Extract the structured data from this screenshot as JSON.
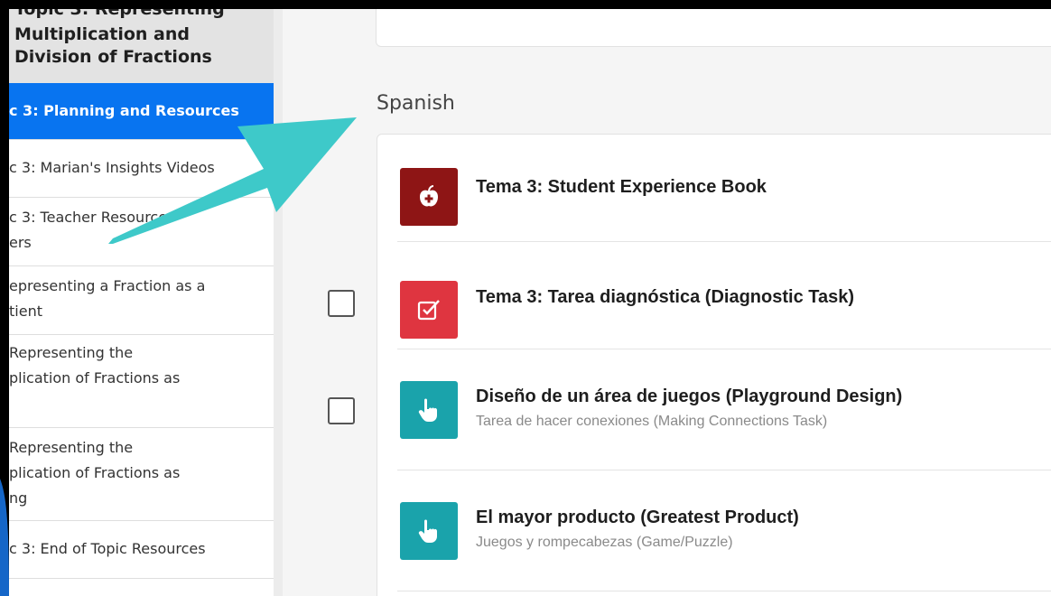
{
  "sidebar": {
    "topic_header": [
      "Topic 3: Representing",
      "Multiplication and",
      "Division of Fractions"
    ],
    "items": [
      {
        "lines": [
          "c 3: Planning and Resources"
        ],
        "active": true
      },
      {
        "lines": [
          "c 3: Marian's Insights Videos"
        ],
        "active": false
      },
      {
        "lines": [
          "c 3: Teacher Resource",
          "ers"
        ],
        "active": false
      },
      {
        "lines": [
          "epresenting a Fraction as a",
          "tient"
        ],
        "active": false
      },
      {
        "lines": [
          "Representing the",
          "plication of Fractions as",
          ""
        ],
        "active": false
      },
      {
        "lines": [
          "Representing the",
          "plication of Fractions as",
          "ng"
        ],
        "active": false
      },
      {
        "lines": [
          "c 3: End of Topic Resources"
        ],
        "active": false
      }
    ]
  },
  "main": {
    "section_title": "Spanish",
    "resources": [
      {
        "title": "Tema 3: Student Experience Book",
        "subtitle": "",
        "icon": "apple-icon",
        "color": "#8e1515",
        "checkbox": false
      },
      {
        "title": "Tema 3: Tarea diagnóstica (Diagnostic Task)",
        "subtitle": "",
        "icon": "checkbox-pencil-icon",
        "color": "#df3540",
        "checkbox": true
      },
      {
        "title": "Diseño de un área de juegos (Playground Design)",
        "subtitle": "Tarea de hacer conexiones (Making Connections Task)",
        "icon": "pointing-hand-icon",
        "color": "#1aa3ab",
        "checkbox": true
      },
      {
        "title": "El mayor producto (Greatest Product)",
        "subtitle": "Juegos y rompecabezas (Game/Puzzle)",
        "icon": "pointing-hand-icon",
        "color": "#1aa3ab",
        "checkbox": false
      }
    ]
  },
  "annotation": {
    "arrow_color": "#3ec9c9"
  }
}
